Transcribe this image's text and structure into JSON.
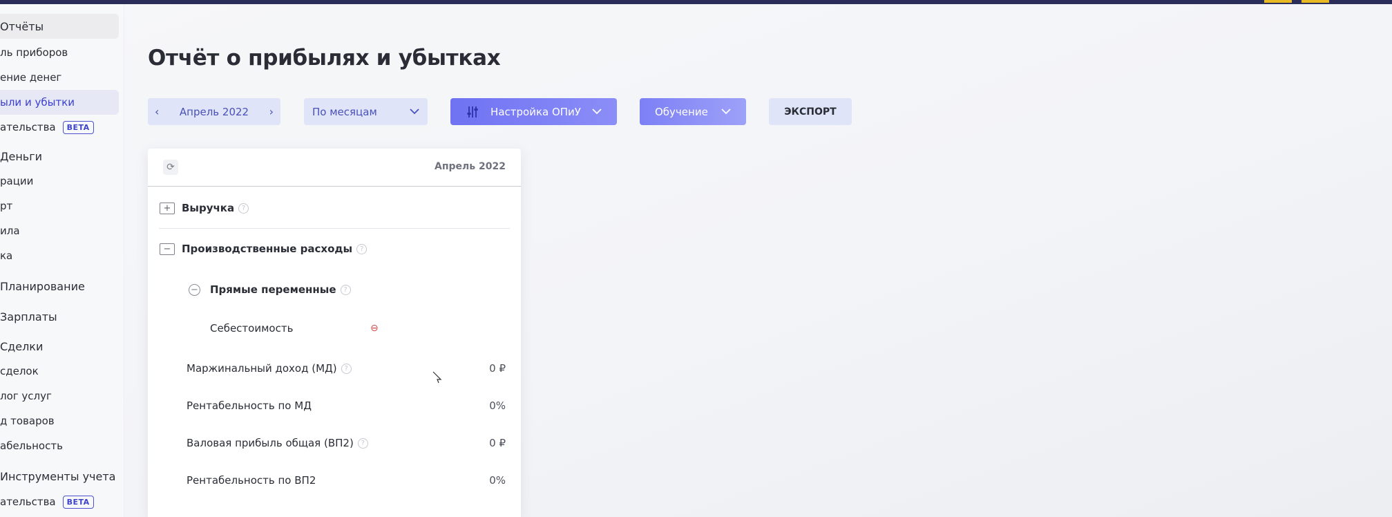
{
  "sidebar": {
    "items": [
      {
        "label": "Отчёты",
        "kind": "section"
      },
      {
        "label": "ль приборов",
        "kind": "item"
      },
      {
        "label": "ение денег",
        "kind": "item"
      },
      {
        "label": "ыли и убытки",
        "kind": "active"
      },
      {
        "label": "ательства",
        "kind": "item",
        "badge": "BETA"
      },
      {
        "label": "Деньги",
        "kind": "section"
      },
      {
        "label": "рации",
        "kind": "item"
      },
      {
        "label": "рт",
        "kind": "item"
      },
      {
        "label": "ила",
        "kind": "item"
      },
      {
        "label": "ка",
        "kind": "item"
      },
      {
        "label": "Планирование",
        "kind": "section"
      },
      {
        "label": "Зарплаты",
        "kind": "section"
      },
      {
        "label": "Сделки",
        "kind": "section"
      },
      {
        "label": "сделок",
        "kind": "item"
      },
      {
        "label": "лог услуг",
        "kind": "item"
      },
      {
        "label": "д товаров",
        "kind": "item"
      },
      {
        "label": "абельность",
        "kind": "item"
      },
      {
        "label": "Инструменты учета",
        "kind": "section"
      },
      {
        "label": "ательства",
        "kind": "item",
        "badge": "BETA"
      }
    ]
  },
  "page": {
    "title": "Отчёт о прибылях и убытках"
  },
  "toolbar": {
    "date_prev_icon": "‹",
    "date_label": "Апрель 2022",
    "date_next_icon": "›",
    "period_label": "По месяцам",
    "settings_label": "Настройка ОПиУ",
    "learn_label": "Обучение",
    "export_label": "ЭКСПОРТ"
  },
  "report": {
    "header_period": "Апрель 2022",
    "rows": [
      {
        "label": "Выручка",
        "icon": "folder-plus-icon",
        "help": true,
        "value": ""
      },
      {
        "label": "Производственные расходы",
        "icon": "folder-minus-icon",
        "help": true,
        "value": ""
      },
      {
        "label": "Прямые переменные",
        "icon": "circle-minus-icon",
        "help": true,
        "value": ""
      },
      {
        "label": "Себестоимость",
        "icon": "link-icon",
        "help": false,
        "value": ""
      },
      {
        "label": "Маржинальный доход (МД)",
        "help": true,
        "value": "0 ₽"
      },
      {
        "label": "Рентабельность по МД",
        "help": false,
        "value": "0%"
      },
      {
        "label": "Валовая прибыль общая (ВП2)",
        "help": true,
        "value": "0 ₽"
      },
      {
        "label": "Рентабельность по ВП2",
        "help": false,
        "value": "0%"
      }
    ]
  },
  "colors": {
    "accent": "#6f72f2",
    "active_nav": "#3a3fcf",
    "button_light": "#dfe4f8",
    "topbar": "#2a2c5a",
    "link_icon": "#d04a4a"
  }
}
